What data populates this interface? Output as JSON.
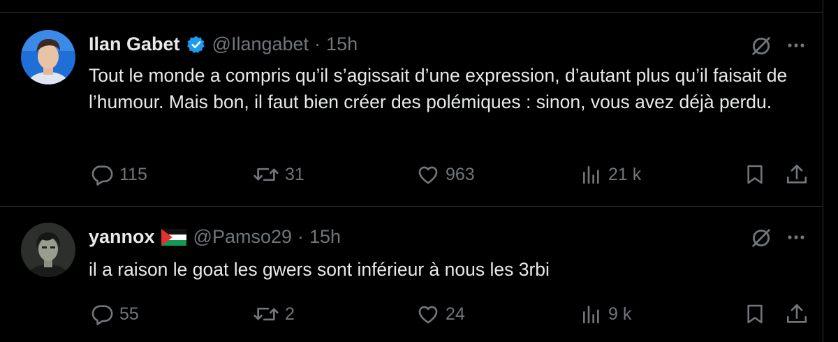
{
  "tweets": [
    {
      "name": "Ilan Gabet",
      "handle": "@Ilangabet",
      "separator": "·",
      "time": "15h",
      "verified": true,
      "text": "Tout le monde a compris qu’il s’agissait d’une expression, d’autant plus qu’il faisait de l’humour. Mais bon, il faut bien créer des polémiques : sinon, vous avez déjà perdu.",
      "replies": "115",
      "retweets": "31",
      "likes": "963",
      "views": "21 k"
    },
    {
      "name": "yannox",
      "handle": "@Pamso29",
      "separator": "·",
      "time": "15h",
      "flag": "palestine-flag",
      "text": "il a raison le goat les gwers sont inférieur à nous les 3rbi",
      "replies": "55",
      "retweets": "2",
      "likes": "24",
      "views": "9 k"
    }
  ],
  "colors": {
    "background": "#000000",
    "text": "#e7e9ea",
    "muted": "#71767b",
    "border": "#2f3336",
    "verified": "#1d9bf0"
  },
  "icons": [
    "grok-icon",
    "more-icon",
    "reply-icon",
    "retweet-icon",
    "like-icon",
    "views-icon",
    "bookmark-icon",
    "share-icon",
    "verified-badge-icon"
  ]
}
